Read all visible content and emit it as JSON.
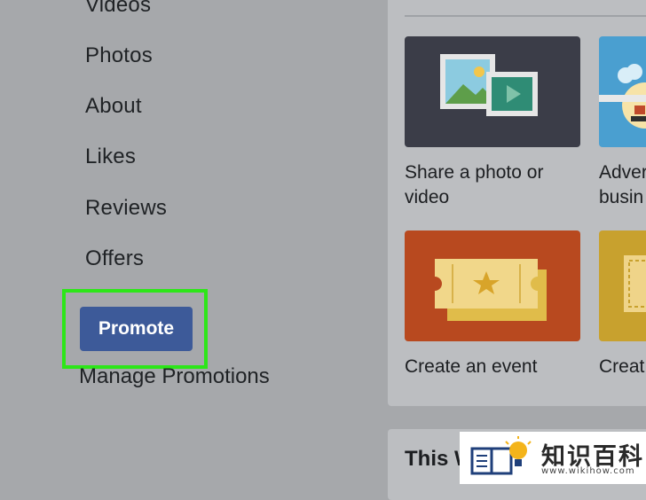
{
  "sidebar": {
    "items": [
      {
        "label": "Videos"
      },
      {
        "label": "Photos"
      },
      {
        "label": "About"
      },
      {
        "label": "Likes"
      },
      {
        "label": "Reviews"
      },
      {
        "label": "Offers"
      }
    ],
    "promote_label": "Promote",
    "manage_label": "Manage Promotions"
  },
  "cards": [
    {
      "line1": "Share a photo or",
      "line2": "video",
      "icon": "photo-video-icon",
      "color": "#3b3d48"
    },
    {
      "line1": "Adver",
      "line2": "busin",
      "icon": "advertise-icon",
      "color": "#4a9fd0"
    },
    {
      "line1": "Create an event",
      "icon": "ticket-icon",
      "color": "#b8491f"
    },
    {
      "line1": "Creat",
      "icon": "offer-icon",
      "color": "#c8a12e"
    }
  ],
  "section": {
    "title": "This W"
  },
  "watermark": {
    "title": "知识百科",
    "url": "www.wikihow.com"
  },
  "colors": {
    "highlight": "#2de619",
    "button": "#3d5a99",
    "background": "#a6a8ab"
  }
}
